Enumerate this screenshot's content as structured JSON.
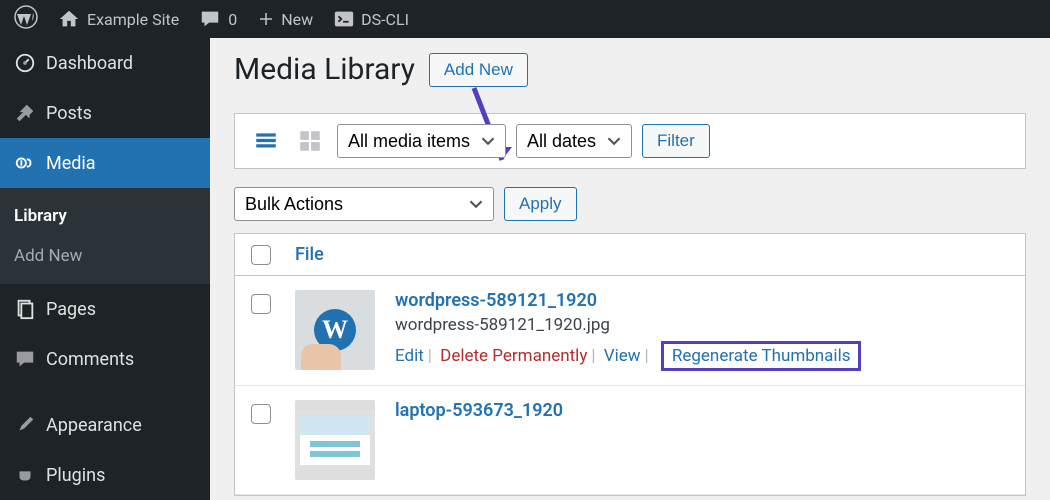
{
  "toolbar": {
    "site_name": "Example Site",
    "comment_count": "0",
    "new_label": "New",
    "cli_label": "DS-CLI"
  },
  "sidebar": {
    "items": [
      {
        "label": "Dashboard",
        "icon": "dashboard"
      },
      {
        "label": "Posts",
        "icon": "pin"
      },
      {
        "label": "Media",
        "icon": "media"
      },
      {
        "label": "Pages",
        "icon": "pages"
      },
      {
        "label": "Comments",
        "icon": "comment"
      },
      {
        "label": "Appearance",
        "icon": "brush"
      },
      {
        "label": "Plugins",
        "icon": "plug"
      }
    ],
    "media_sub": {
      "library": "Library",
      "add_new": "Add New"
    }
  },
  "page": {
    "title": "Media Library",
    "add_new": "Add New"
  },
  "filters": {
    "type": "All media items",
    "dates": "All dates",
    "filter_btn": "Filter"
  },
  "bulk": {
    "label": "Bulk Actions",
    "apply": "Apply"
  },
  "table": {
    "col_file": "File",
    "rows": [
      {
        "title": "wordpress-589121_1920",
        "filename": "wordpress-589121_1920.jpg",
        "actions": {
          "edit": "Edit",
          "delete": "Delete Permanently",
          "view": "View",
          "regenerate": "Regenerate Thumbnails"
        }
      },
      {
        "title": "laptop-593673_1920",
        "filename": "",
        "actions": {}
      }
    ]
  }
}
